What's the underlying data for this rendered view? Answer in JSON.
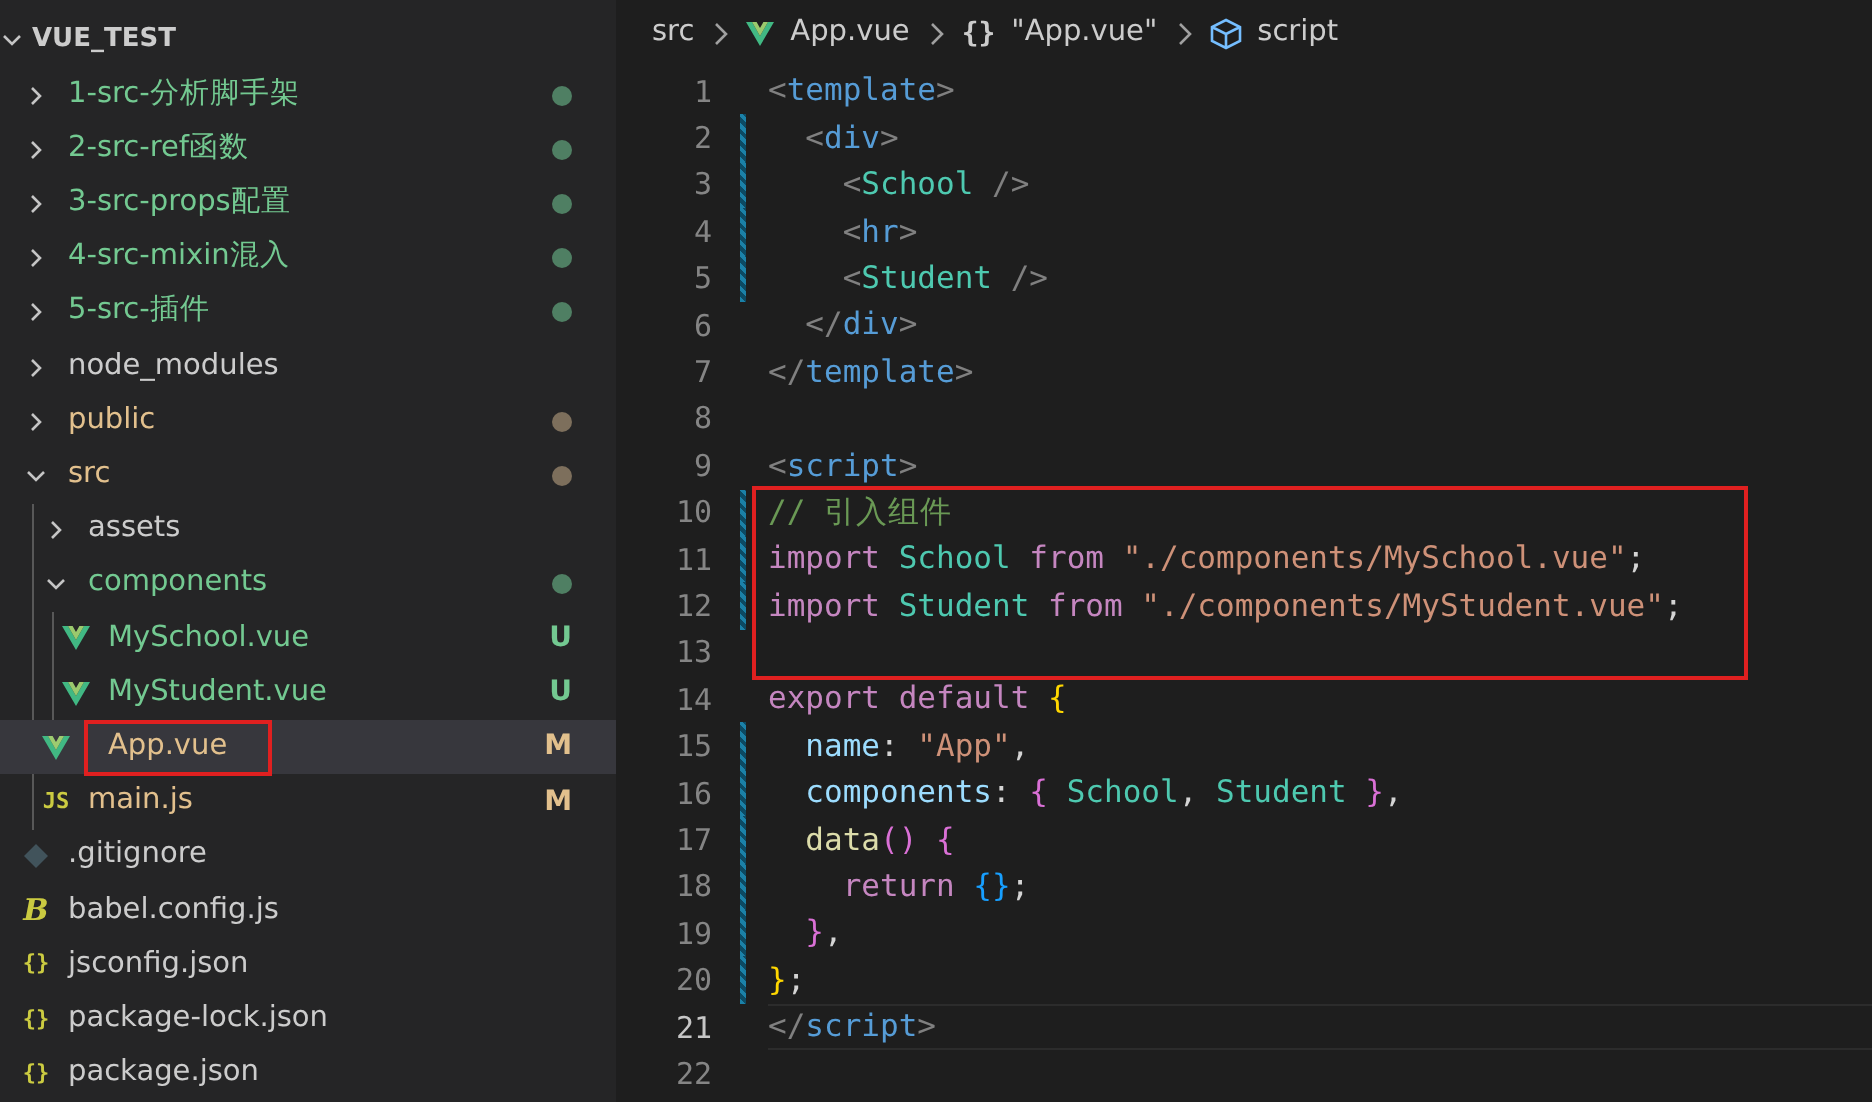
{
  "explorer": {
    "title": "VUE_TEST",
    "expanded": true,
    "items": [
      {
        "name": "1-src-分析脚手架",
        "kind": "folder",
        "expanded": false,
        "color": "#73c991",
        "dot": {
          "color": "#4f7f63"
        },
        "selected": false
      },
      {
        "name": "2-src-ref函数",
        "kind": "folder",
        "expanded": false,
        "color": "#73c991",
        "dot": {
          "color": "#4f7f63"
        },
        "selected": false
      },
      {
        "name": "3-src-props配置",
        "kind": "folder",
        "expanded": false,
        "color": "#73c991",
        "dot": {
          "color": "#4f7f63"
        },
        "selected": false
      },
      {
        "name": "4-src-mixin混入",
        "kind": "folder",
        "expanded": false,
        "color": "#73c991",
        "dot": {
          "color": "#4f7f63"
        },
        "selected": false
      },
      {
        "name": "5-src-插件",
        "kind": "folder",
        "expanded": false,
        "color": "#73c991",
        "dot": {
          "color": "#4f7f63"
        },
        "selected": false
      },
      {
        "name": "node_modules",
        "kind": "folder",
        "expanded": false,
        "color": "#cccccc",
        "selected": false
      },
      {
        "name": "public",
        "kind": "folder",
        "expanded": false,
        "color": "#e2c08d",
        "dot": {
          "color": "#7d6f5c"
        },
        "selected": false
      },
      {
        "name": "src",
        "kind": "folder",
        "expanded": true,
        "color": "#e2c08d",
        "dot": {
          "color": "#7d6f5c"
        },
        "selected": false,
        "children": [
          {
            "name": "assets",
            "kind": "folder",
            "expanded": false,
            "color": "#cccccc",
            "selected": false
          },
          {
            "name": "components",
            "kind": "folder",
            "expanded": true,
            "color": "#73c991",
            "dot": {
              "color": "#4f7f63"
            },
            "selected": false,
            "children": [
              {
                "name": "MySchool.vue",
                "kind": "vue",
                "color": "#73c991",
                "badge": "U",
                "selected": false
              },
              {
                "name": "MyStudent.vue",
                "kind": "vue",
                "color": "#73c991",
                "badge": "U",
                "selected": false
              }
            ]
          },
          {
            "name": "App.vue",
            "kind": "vue",
            "color": "#e2c08d",
            "badge": "M",
            "selected": true,
            "boxed": true
          },
          {
            "name": "main.js",
            "kind": "js",
            "icon": "JS",
            "color": "#e2c08d",
            "badge": "M",
            "selected": false
          }
        ]
      },
      {
        "name": ".gitignore",
        "kind": "git",
        "color": "#cccccc",
        "selected": false
      },
      {
        "name": "babel.config.js",
        "kind": "babel",
        "icon": "B",
        "color": "#cccccc",
        "selected": false
      },
      {
        "name": "jsconfig.json",
        "kind": "json",
        "icon": "{}",
        "color": "#cccccc",
        "selected": false
      },
      {
        "name": "package-lock.json",
        "kind": "json",
        "icon": "{}",
        "color": "#cccccc",
        "selected": false
      },
      {
        "name": "package.json",
        "kind": "json",
        "icon": "{}",
        "color": "#cccccc",
        "selected": false
      }
    ]
  },
  "breadcrumbs": [
    {
      "text": "src",
      "kind": "folder"
    },
    {
      "text": "App.vue",
      "kind": "vue"
    },
    {
      "text": "\"App.vue\"",
      "kind": "module",
      "icon": "{}"
    },
    {
      "text": "script",
      "kind": "element"
    }
  ],
  "code": [
    {
      "number": "1",
      "changed": false,
      "current": false,
      "boxed": false,
      "tokens": [
        {
          "t": "<",
          "color": "#808080"
        },
        {
          "t": "template",
          "color": "#569cd6"
        },
        {
          "t": ">",
          "color": "#808080"
        }
      ]
    },
    {
      "number": "2",
      "changed": true,
      "current": false,
      "boxed": false,
      "tokens": [
        {
          "t": "  <",
          "color": "#808080"
        },
        {
          "t": "div",
          "color": "#569cd6"
        },
        {
          "t": ">",
          "color": "#808080"
        }
      ]
    },
    {
      "number": "3",
      "changed": true,
      "current": false,
      "boxed": false,
      "tokens": [
        {
          "t": "    <",
          "color": "#808080"
        },
        {
          "t": "School",
          "color": "#4ec9b0"
        },
        {
          "t": " />",
          "color": "#808080"
        }
      ]
    },
    {
      "number": "4",
      "changed": true,
      "current": false,
      "boxed": false,
      "tokens": [
        {
          "t": "    <",
          "color": "#808080"
        },
        {
          "t": "hr",
          "color": "#569cd6"
        },
        {
          "t": ">",
          "color": "#808080"
        }
      ]
    },
    {
      "number": "5",
      "changed": true,
      "current": false,
      "boxed": false,
      "tokens": [
        {
          "t": "    <",
          "color": "#808080"
        },
        {
          "t": "Student",
          "color": "#4ec9b0"
        },
        {
          "t": " />",
          "color": "#808080"
        }
      ]
    },
    {
      "number": "6",
      "changed": false,
      "current": false,
      "boxed": false,
      "tokens": [
        {
          "t": "  </",
          "color": "#808080"
        },
        {
          "t": "div",
          "color": "#569cd6"
        },
        {
          "t": ">",
          "color": "#808080"
        }
      ]
    },
    {
      "number": "7",
      "changed": false,
      "current": false,
      "boxed": false,
      "tokens": [
        {
          "t": "</",
          "color": "#808080"
        },
        {
          "t": "template",
          "color": "#569cd6"
        },
        {
          "t": ">",
          "color": "#808080"
        }
      ]
    },
    {
      "number": "8",
      "changed": false,
      "current": false,
      "boxed": false
    },
    {
      "number": "9",
      "changed": false,
      "current": false,
      "boxed": false,
      "tokens": [
        {
          "t": "<",
          "color": "#808080"
        },
        {
          "t": "script",
          "color": "#569cd6"
        },
        {
          "t": ">",
          "color": "#808080"
        }
      ]
    },
    {
      "number": "10",
      "changed": true,
      "current": false,
      "boxed": true,
      "tokens": [
        {
          "t": "// 引入组件",
          "color": "#6a9955"
        }
      ]
    },
    {
      "number": "11",
      "changed": true,
      "current": false,
      "boxed": true,
      "tokens": [
        {
          "t": "import ",
          "color": "#c586c0"
        },
        {
          "t": "School ",
          "color": "#4ec9b0"
        },
        {
          "t": "from ",
          "color": "#c586c0"
        },
        {
          "t": "\"./components/MySchool.vue\"",
          "color": "#ce9178"
        },
        {
          "t": ";",
          "color": "#d4d4d4"
        }
      ]
    },
    {
      "number": "12",
      "changed": true,
      "current": false,
      "boxed": true,
      "tokens": [
        {
          "t": "import ",
          "color": "#c586c0"
        },
        {
          "t": "Student ",
          "color": "#4ec9b0"
        },
        {
          "t": "from ",
          "color": "#c586c0"
        },
        {
          "t": "\"./components/MyStudent.vue\"",
          "color": "#ce9178"
        },
        {
          "t": ";",
          "color": "#d4d4d4"
        }
      ]
    },
    {
      "number": "13",
      "changed": false,
      "current": false,
      "boxed": true
    },
    {
      "number": "14",
      "changed": false,
      "current": false,
      "boxed": false,
      "tokens": [
        {
          "t": "export ",
          "color": "#c586c0"
        },
        {
          "t": "default ",
          "color": "#c586c0"
        },
        {
          "t": "{",
          "color": "#ffd700"
        }
      ]
    },
    {
      "number": "15",
      "changed": true,
      "current": false,
      "boxed": false,
      "tokens": [
        {
          "t": "  name",
          "color": "#9cdcfe"
        },
        {
          "t": ": ",
          "color": "#d4d4d4"
        },
        {
          "t": "\"App\"",
          "color": "#ce9178"
        },
        {
          "t": ",",
          "color": "#d4d4d4"
        }
      ]
    },
    {
      "number": "16",
      "changed": true,
      "current": false,
      "boxed": false,
      "tokens": [
        {
          "t": "  components",
          "color": "#9cdcfe"
        },
        {
          "t": ": ",
          "color": "#d4d4d4"
        },
        {
          "t": "{ ",
          "color": "#da70d6"
        },
        {
          "t": "School",
          "color": "#4ec9b0"
        },
        {
          "t": ", ",
          "color": "#d4d4d4"
        },
        {
          "t": "Student ",
          "color": "#4ec9b0"
        },
        {
          "t": "}",
          "color": "#da70d6"
        },
        {
          "t": ",",
          "color": "#d4d4d4"
        }
      ]
    },
    {
      "number": "17",
      "changed": true,
      "current": false,
      "boxed": false,
      "tokens": [
        {
          "t": "  data",
          "color": "#dcdcaa"
        },
        {
          "t": "() {",
          "color": "#da70d6"
        }
      ]
    },
    {
      "number": "18",
      "changed": true,
      "current": false,
      "boxed": false,
      "tokens": [
        {
          "t": "    return ",
          "color": "#c586c0"
        },
        {
          "t": "{}",
          "color": "#179fff"
        },
        {
          "t": ";",
          "color": "#d4d4d4"
        }
      ]
    },
    {
      "number": "19",
      "changed": true,
      "current": false,
      "boxed": false,
      "tokens": [
        {
          "t": "  }",
          "color": "#da70d6"
        },
        {
          "t": ",",
          "color": "#d4d4d4"
        }
      ]
    },
    {
      "number": "20",
      "changed": true,
      "current": false,
      "boxed": false,
      "tokens": [
        {
          "t": "}",
          "color": "#ffd700"
        },
        {
          "t": ";",
          "color": "#d4d4d4"
        }
      ]
    },
    {
      "number": "21",
      "changed": false,
      "current": true,
      "boxed": false,
      "tokens": [
        {
          "t": "</",
          "color": "#808080"
        },
        {
          "t": "script",
          "color": "#569cd6"
        },
        {
          "t": ">",
          "color": "#808080"
        }
      ]
    },
    {
      "number": "22",
      "changed": false,
      "current": false,
      "boxed": false
    }
  ]
}
